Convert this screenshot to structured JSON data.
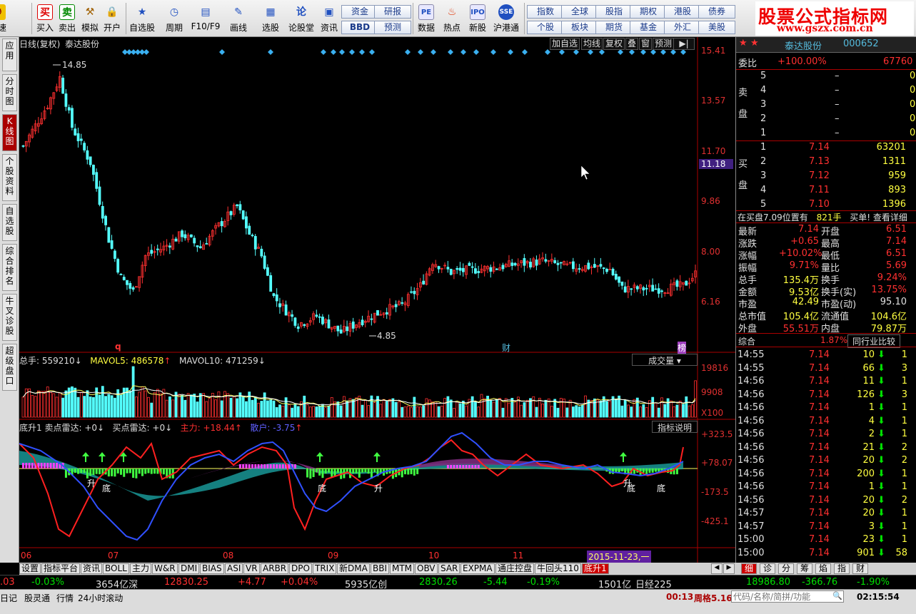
{
  "toolbar": {
    "buttons": [
      "买入",
      "卖出",
      "模拟",
      "开户",
      "自选股",
      "周期",
      "F10/F9",
      "画线",
      "选股",
      "论股堂",
      "资讯",
      "数据",
      "热点",
      "新股",
      "沪港通",
      "测速"
    ],
    "small_buttons_1": [
      "资金",
      "研报",
      "BBD",
      "预测"
    ],
    "small_buttons_2": [
      "指数",
      "全球",
      "股指",
      "期权",
      "港股",
      "债券",
      "个股",
      "板块",
      "期货",
      "基金",
      "外汇",
      "美股"
    ],
    "logo_line1": "股票公式指标网",
    "logo_line2": "www.gszx.com.cn"
  },
  "left_tabs": [
    "应用",
    "分时图",
    "K线图",
    "个股资料",
    "自选股",
    "综合排名",
    "牛叉诊股",
    "超级盘口"
  ],
  "chart": {
    "title": "日线(复权)",
    "stock_name": "泰达股份",
    "top_buttons": [
      "加自选",
      "均线",
      "复权",
      "叠",
      "窗",
      "预测"
    ],
    "price_axis": [
      "15.41",
      "13.57",
      "11.70",
      "9.86",
      "8.00",
      "6.16"
    ],
    "current_price_tag": "11.18",
    "high_label": "14.85",
    "low_label": "4.85",
    "marker_q": "q",
    "marker_cai": "财",
    "marker_bang": "榜",
    "vol_header": {
      "total": "总手: 559210",
      "mavol5": "MAVOL5: 486578",
      "mavol10": "MAVOL10: 471259"
    },
    "vol_btn": "成交量",
    "vol_axis": [
      "19816",
      "9908",
      "X100"
    ],
    "ind_header": {
      "name": "底升1",
      "sell": "卖点雷达: +0",
      "buy": "买点雷达: +0",
      "main": "主力: +18.44",
      "retail": "散户: -3.75"
    },
    "ind_btn": "指标说明",
    "ind_axis": [
      "+323.5",
      "+78.07",
      "-173.5",
      "-425.1"
    ],
    "ind_text_sheng": "升",
    "ind_text_di": "底",
    "date_axis": [
      "06",
      "07",
      "08",
      "09",
      "10",
      "11"
    ],
    "date_cursor": "2015-11-23,一"
  },
  "chart_data": {
    "type": "candlestick",
    "title": "日线(复权)",
    "ylim": [
      4.85,
      15.41
    ],
    "high": 14.85,
    "low": 4.85,
    "last": 7.14
  },
  "right": {
    "stock_name": "泰达股份",
    "stock_code": "000652",
    "weibi_label": "委比",
    "weibi_value": "+100.00%",
    "weibi_diff": "67760",
    "sell_label": "卖盘",
    "buy_label": "买盘",
    "asks": [
      {
        "lvl": "5",
        "price": "–",
        "vol": "0"
      },
      {
        "lvl": "4",
        "price": "–",
        "vol": "0"
      },
      {
        "lvl": "3",
        "price": "–",
        "vol": "0"
      },
      {
        "lvl": "2",
        "price": "–",
        "vol": "0"
      },
      {
        "lvl": "1",
        "price": "–",
        "vol": "0"
      }
    ],
    "bids": [
      {
        "lvl": "1",
        "price": "7.14",
        "vol": "63201"
      },
      {
        "lvl": "2",
        "price": "7.13",
        "vol": "1311"
      },
      {
        "lvl": "3",
        "price": "7.12",
        "vol": "959"
      },
      {
        "lvl": "4",
        "price": "7.11",
        "vol": "893"
      },
      {
        "lvl": "5",
        "price": "7.10",
        "vol": "1396"
      }
    ],
    "notice": {
      "text": "在买盘7.09位置有",
      "vol": "821手",
      "tail": "买单! 查看详细"
    },
    "quotes": [
      [
        "最新",
        "7.14",
        "开盘",
        "6.51"
      ],
      [
        "涨跌",
        "+0.65",
        "最高",
        "7.14"
      ],
      [
        "涨幅",
        "+10.02%",
        "最低",
        "6.51"
      ],
      [
        "振幅",
        "9.71%",
        "量比",
        "5.69"
      ],
      [
        "总手",
        "135.4万",
        "换手",
        "9.24%"
      ],
      [
        "金额",
        "9.53亿",
        "换手(实)",
        "13.75%"
      ],
      [
        "市盈",
        "42.49",
        "市盈(动)",
        "95.10"
      ],
      [
        "总市值",
        "105.4亿",
        "流通值",
        "104.6亿"
      ],
      [
        "外盘",
        "55.51万",
        "内盘",
        "79.87万"
      ]
    ],
    "composite_label": "综合",
    "composite_value": "1.87%",
    "industry_btn": "同行业比较",
    "ticks": [
      [
        "14:55",
        "7.14",
        "10",
        "1"
      ],
      [
        "14:55",
        "7.14",
        "66",
        "3"
      ],
      [
        "14:56",
        "7.14",
        "11",
        "1"
      ],
      [
        "14:56",
        "7.14",
        "126",
        "3"
      ],
      [
        "14:56",
        "7.14",
        "1",
        "1"
      ],
      [
        "14:56",
        "7.14",
        "4",
        "1"
      ],
      [
        "14:56",
        "7.14",
        "2",
        "1"
      ],
      [
        "14:56",
        "7.14",
        "21",
        "2"
      ],
      [
        "14:56",
        "7.14",
        "20",
        "2"
      ],
      [
        "14:56",
        "7.14",
        "200",
        "1"
      ],
      [
        "14:56",
        "7.14",
        "1",
        "1"
      ],
      [
        "14:56",
        "7.14",
        "20",
        "2"
      ],
      [
        "14:57",
        "7.14",
        "20",
        "1"
      ],
      [
        "14:57",
        "7.14",
        "3",
        "1"
      ],
      [
        "15:00",
        "7.14",
        "23",
        "1"
      ],
      [
        "15:00",
        "7.14",
        "901",
        "58"
      ]
    ]
  },
  "bottom_tabs": [
    "设置",
    "指标平台",
    "资讯",
    "BOLL",
    "主力",
    "W&R",
    "DMI",
    "BIAS",
    "ASI",
    "VR",
    "ARBR",
    "DPO",
    "TRIX",
    "新DMA",
    "BBI",
    "MTM",
    "OBV",
    "SAR",
    "EXPMA",
    "通庄控盘",
    "牛回头110",
    "底升1"
  ],
  "right_tabs": [
    "细",
    "诊",
    "分",
    "筹",
    "焰",
    "指",
    "财"
  ],
  "status1": {
    "sh_change": ".03",
    "sh_pct": "-0.03%",
    "sz_amount": "3654亿深",
    "sz_index": "12830.25",
    "sz_change": "+4.77",
    "sz_pct": "+0.04%",
    "cy_amount": "5935亿创",
    "cy_index": "2830.26",
    "cy_change": "-5.44",
    "cy_pct": "-0.19%",
    "nk_amount": "1501亿",
    "nk_name": "日经225",
    "nk_index": "18986.80",
    "nk_change": "-366.76",
    "nk_pct": "-1.90%"
  },
  "status2": {
    "items": [
      "日记",
      "股灵通",
      "行情",
      "24小时滚动"
    ],
    "time_cd": "00:13",
    "week": "周格5.16",
    "search_placeholder": "代码/名称/简拼/功能",
    "clock": "02:15:54"
  }
}
